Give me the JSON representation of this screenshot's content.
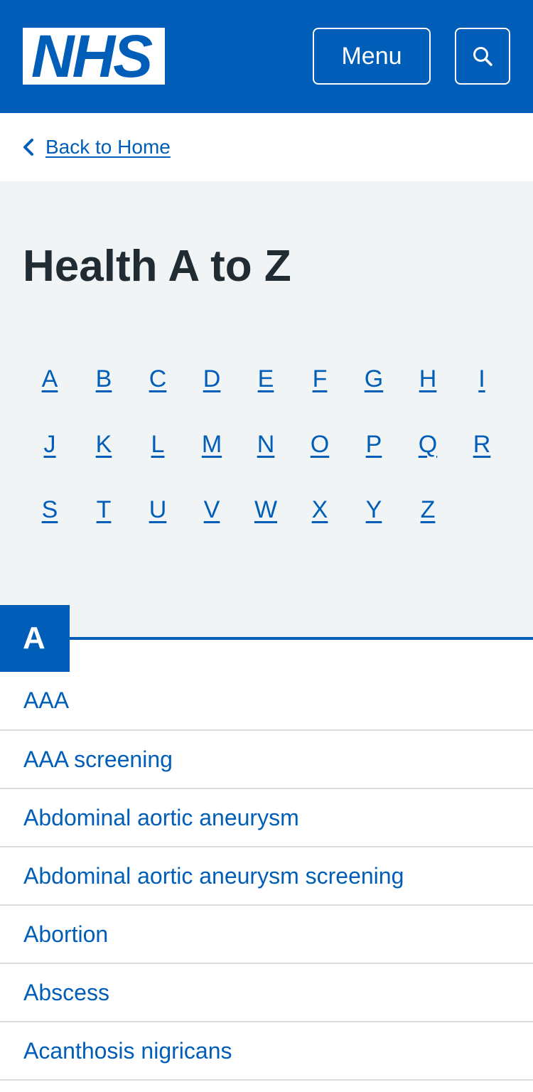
{
  "header": {
    "logo_text": "NHS",
    "menu_label": "Menu",
    "search_icon": "search-icon",
    "background_color": "#005eb8"
  },
  "breadcrumb": {
    "icon": "chevron-left-icon",
    "label": "Back to Home"
  },
  "page": {
    "title": "Health A to Z",
    "background_color": "#f0f4f5"
  },
  "alphabet": [
    "A",
    "B",
    "C",
    "D",
    "E",
    "F",
    "G",
    "H",
    "I",
    "J",
    "K",
    "L",
    "M",
    "N",
    "O",
    "P",
    "Q",
    "R",
    "S",
    "T",
    "U",
    "V",
    "W",
    "X",
    "Y",
    "Z"
  ],
  "section": {
    "letter": "A",
    "items": [
      "AAA",
      "AAA screening",
      "Abdominal aortic aneurysm",
      "Abdominal aortic aneurysm screening",
      "Abortion",
      "Abscess",
      "Acanthosis nigricans"
    ]
  },
  "colors": {
    "link": "#005eb8",
    "text": "#212b32",
    "divider": "#d8dde0"
  }
}
